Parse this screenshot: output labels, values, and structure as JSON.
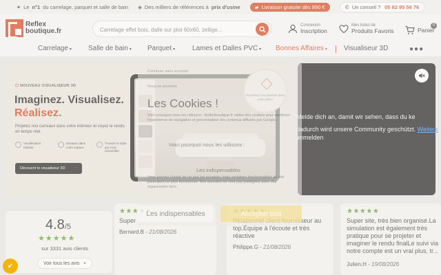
{
  "topbar": {
    "items": [
      {
        "pre": "Le ",
        "bold": "n°1",
        "post": " du carrelage, parquet et salle de bain"
      },
      {
        "pre": "Des milliers de références à ",
        "bold": "prix d'usine",
        "post": ""
      }
    ],
    "shipping": "Livraison gratuite dès 890 €",
    "advice_label": "Un conseil ?",
    "phone": "05 82 95 56 76"
  },
  "logo": {
    "line1": "Reflex",
    "line2": "boutique.fr"
  },
  "search": {
    "placeholder": "Carrelage effet bois, dalle sur plot 60x60, zellige..."
  },
  "account": {
    "small": "Connexion",
    "big": "Inscription"
  },
  "favorites": {
    "small": "Mes listes de",
    "big": "Produits Favoris"
  },
  "cart": {
    "label": "Panier",
    "count": "0"
  },
  "nav": {
    "items": [
      "Carrelage",
      "Salle de bain",
      "Parquet",
      "Lames et Dalles PVC",
      "Bonnes Affaires",
      "Visualiseur 3D"
    ],
    "accent": "#d8411b"
  },
  "hero": {
    "tag": "NOUVEAU VISUALISEUR 3D",
    "title1": "Imaginez. Visualisez.",
    "title2": "Réalisez.",
    "desc": "Projetez nos carreaux dans votre intérieur et voyez le rendu en temps réel.",
    "features": [
      "Visualisation réaliste",
      "Essayez dans votre espace",
      "Trouvez le style qui vous ressemble"
    ],
    "cta": "Découvrir le visualiseur 3D",
    "bubble": "Visualisez nos produits dans votre pièce"
  },
  "video": {
    "bleed1": "Melde dich an, damit wir sehen, dass du ke",
    "bleed2": "dadurch wird unsere Community geschützt.",
    "bleed_link": "Weiters",
    "bleed3": "anmelden"
  },
  "rating": {
    "score": "4.8",
    "den": "/5",
    "stars": "★★★★★",
    "count": "sur 3331 avis clients",
    "button": "Voir tous les avis"
  },
  "reviews": [
    {
      "stars": "★★★★★",
      "text": "Super",
      "author": "Bernard.B",
      "date": "21/08/2026"
    },
    {
      "stars": "★★★★★",
      "text": "Relationnel client fournisseur au top.Équipe à l'écoute et très réactive",
      "author": "Philippe.G",
      "date": "21/08/2026"
    },
    {
      "stars": "★★★★★",
      "text": "Super site, très bien organisé.La simulation est également très pratique pour se projeter et imaginer le rendu finalLe suivi via notre compte est un vrai plus, tr...",
      "author": "Julien.H",
      "date": "19/08/2026"
    }
  ],
  "cookie": {
    "top": "Continuer sans accepter",
    "top2": "Nous ne pouvons",
    "title": "Les Cookies !",
    "text": "Voici pourquoi nous les utilisons : Reflexboutique.fr utilise des cookies pour améliorer l'expérience de navigation et personnaliser les contenus diffusés par Google.",
    "label1": "Voici pourquoi nous les utilisons :",
    "label2": "Les indispensables",
    "text2": "Vous pouvez choisir de ne pas les accepter, mais certaines fonctionnalités du site pourraient ne plus fonctionner. Nos données ne sont pas partagées avec une organisation tiers.",
    "btn1": "Les indispensables",
    "btn2": "Accepter tout"
  }
}
